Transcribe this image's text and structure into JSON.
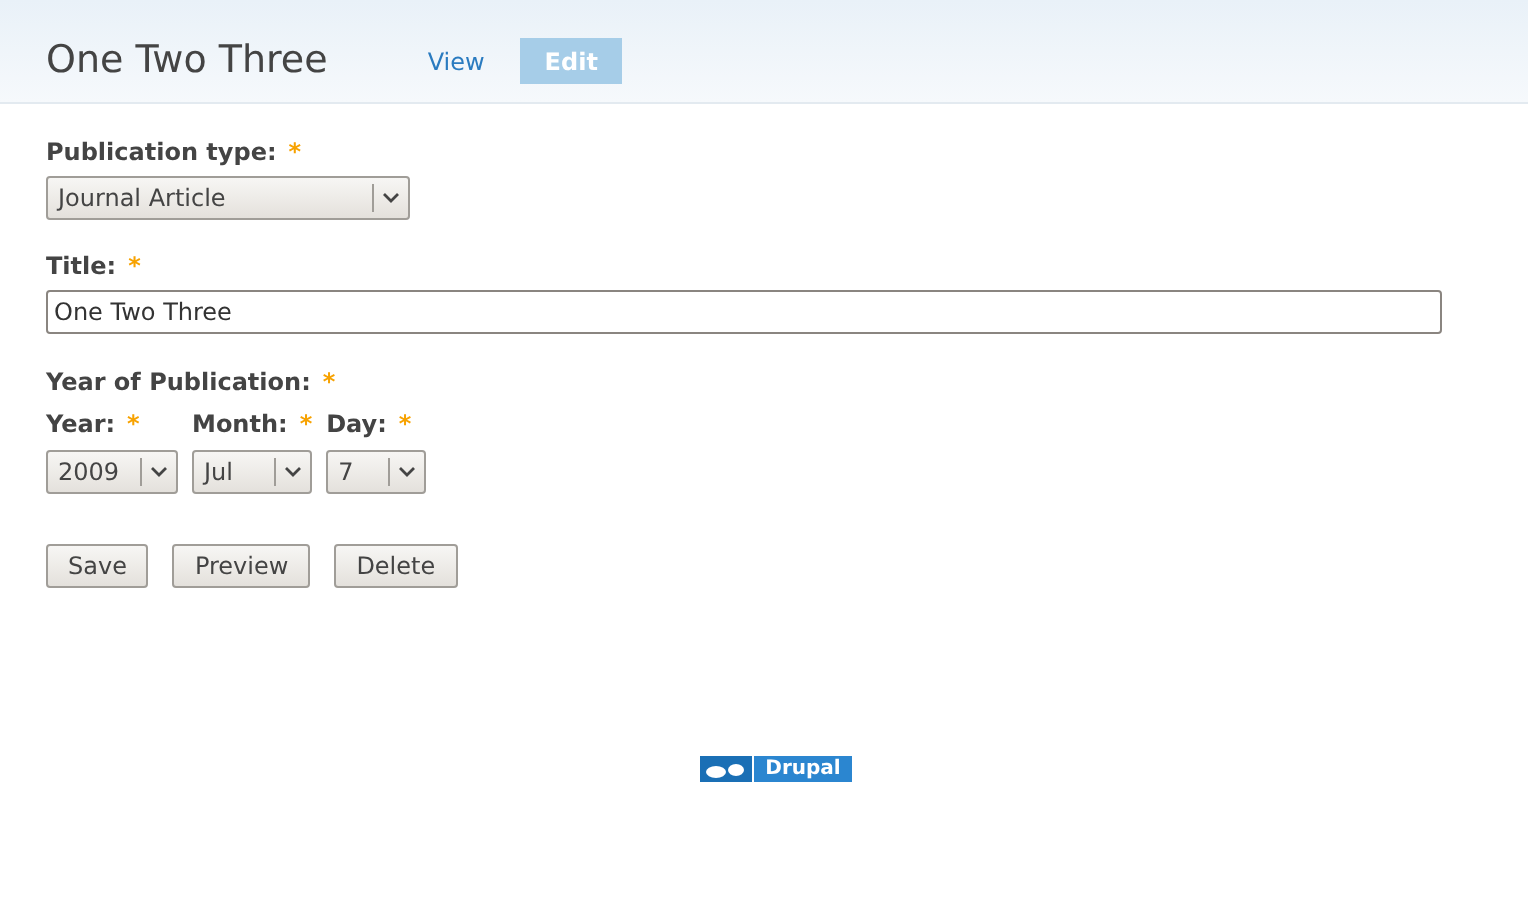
{
  "header": {
    "title": "One Two Three",
    "tabs": [
      {
        "label": "View",
        "selected": false
      },
      {
        "label": "Edit",
        "selected": true
      }
    ]
  },
  "form": {
    "publication_type": {
      "label": "Publication type:",
      "required_mark": "*",
      "value": "Journal Article"
    },
    "title": {
      "label": "Title:",
      "required_mark": "*",
      "value": "One Two Three"
    },
    "year_of_publication": {
      "label": "Year of Publication:",
      "required_mark": "*",
      "parts": [
        {
          "label": "Year:",
          "required_mark": "*",
          "value": "2009"
        },
        {
          "label": "Month:",
          "required_mark": "*",
          "value": "Jul"
        },
        {
          "label": "Day:",
          "required_mark": "*",
          "value": "7"
        }
      ]
    },
    "buttons": [
      "Save",
      "Preview",
      "Delete"
    ]
  },
  "footer": {
    "badge": "Drupal"
  }
}
